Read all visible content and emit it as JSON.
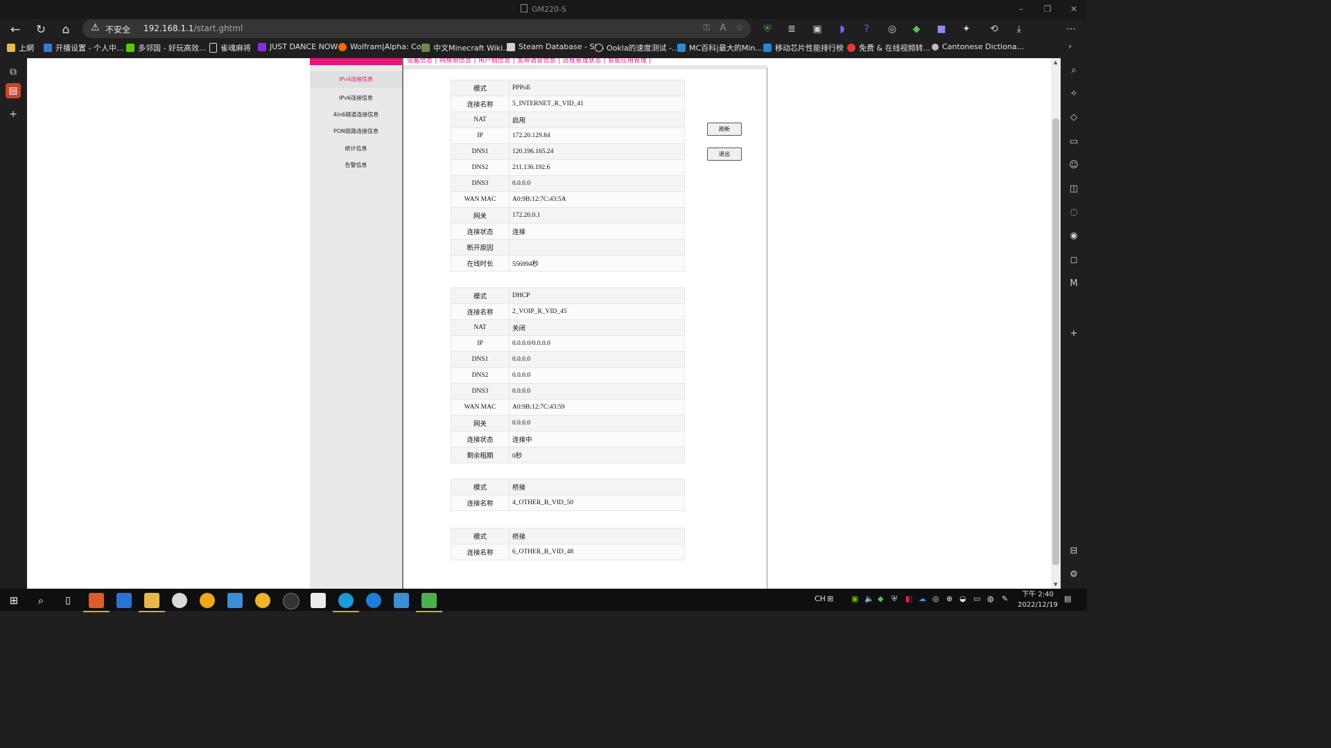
{
  "window": {
    "title": "GM220-S"
  },
  "address_bar": {
    "warning": "不安全",
    "host": "192.168.1.1",
    "path": "/start.ghtml"
  },
  "bookmarks": [
    {
      "label": "上網",
      "color": "#e8b949"
    },
    {
      "label": "开播设置 - 个人中...",
      "color": "#2f7de1"
    },
    {
      "label": "多邻国 - 好玩高效...",
      "color": "#58cc02"
    },
    {
      "label": "雀魂麻将",
      "color": "#dddddd"
    },
    {
      "label": "JUST DANCE NOW",
      "color": "#8b2be2"
    },
    {
      "label": "Wolfram|Alpha: Co...",
      "color": "#ef6c00"
    },
    {
      "label": "中文Minecraft Wiki...",
      "color": "#6d8a4b"
    },
    {
      "label": "Steam Database - St...",
      "color": "#d0d0d0"
    },
    {
      "label": "Ookla的速度测试 -...",
      "color": "#cfcfcf"
    },
    {
      "label": "MC百科|最大的Min...",
      "color": "#2d8ae0"
    },
    {
      "label": "移动芯片性能排行榜",
      "color": "#1e88e5"
    },
    {
      "label": "免费 & 在线视频转...",
      "color": "#e53935"
    },
    {
      "label": "Cantonese Dictiona...",
      "color": "#bdbdbd"
    }
  ],
  "router": {
    "subnav": "设备信息 | 网络侧信息 | 用户侧信息 | 宽带语音信息 | 远程管理状态 | 智能应用管理 |",
    "menu": [
      {
        "label": "IPv4连接信息",
        "selected": true
      },
      {
        "label": "IPv6连接信息",
        "selected": false
      },
      {
        "label": "4in6隧道连接信息",
        "selected": false
      },
      {
        "label": "PON链路连接信息",
        "selected": false
      },
      {
        "label": "统计信息",
        "selected": false
      },
      {
        "label": "告警信息",
        "selected": false
      }
    ],
    "buttons": {
      "refresh": "刷新",
      "logout": "退出"
    },
    "tables": [
      [
        {
          "k": "模式",
          "v": "PPPoE"
        },
        {
          "k": "连接名称",
          "v": "5_INTERNET_R_VID_41"
        },
        {
          "k": "NAT",
          "v": "启用"
        },
        {
          "k": "IP",
          "v": "172.20.129.84"
        },
        {
          "k": "DNS1",
          "v": "120.196.165.24"
        },
        {
          "k": "DNS2",
          "v": "211.136.192.6"
        },
        {
          "k": "DNS3",
          "v": "0.0.0.0"
        },
        {
          "k": "WAN MAC",
          "v": "A0:9B:12:7C:43:5A"
        },
        {
          "k": "网关",
          "v": "172.20.0.1"
        },
        {
          "k": "连接状态",
          "v": "连接"
        },
        {
          "k": "断开原因",
          "v": ""
        },
        {
          "k": "在线时长",
          "v": "556994秒"
        }
      ],
      [
        {
          "k": "模式",
          "v": "DHCP"
        },
        {
          "k": "连接名称",
          "v": "2_VOIP_R_VID_45"
        },
        {
          "k": "NAT",
          "v": "关闭"
        },
        {
          "k": "IP",
          "v": "0.0.0.0/0.0.0.0"
        },
        {
          "k": "DNS1",
          "v": "0.0.0.0"
        },
        {
          "k": "DNS2",
          "v": "0.0.0.0"
        },
        {
          "k": "DNS3",
          "v": "0.0.0.0"
        },
        {
          "k": "WAN MAC",
          "v": "A0:9B:12:7C:43:59"
        },
        {
          "k": "网关",
          "v": "0.0.0.0"
        },
        {
          "k": "连接状态",
          "v": "连接中"
        },
        {
          "k": "剩余租期",
          "v": "0秒"
        }
      ],
      [
        {
          "k": "模式",
          "v": "桥接"
        },
        {
          "k": "连接名称",
          "v": "4_OTHER_B_VID_50"
        }
      ],
      [
        {
          "k": "模式",
          "v": "桥接"
        },
        {
          "k": "连接名称",
          "v": "6_OTHER_B_VID_48"
        }
      ]
    ]
  },
  "taskbar": {
    "ime": "CH",
    "time": "下午 2:40",
    "date": "2022/12/19"
  },
  "colors": {
    "accent_pink": "#e5167a",
    "taskbar_active": "#e7b000"
  }
}
